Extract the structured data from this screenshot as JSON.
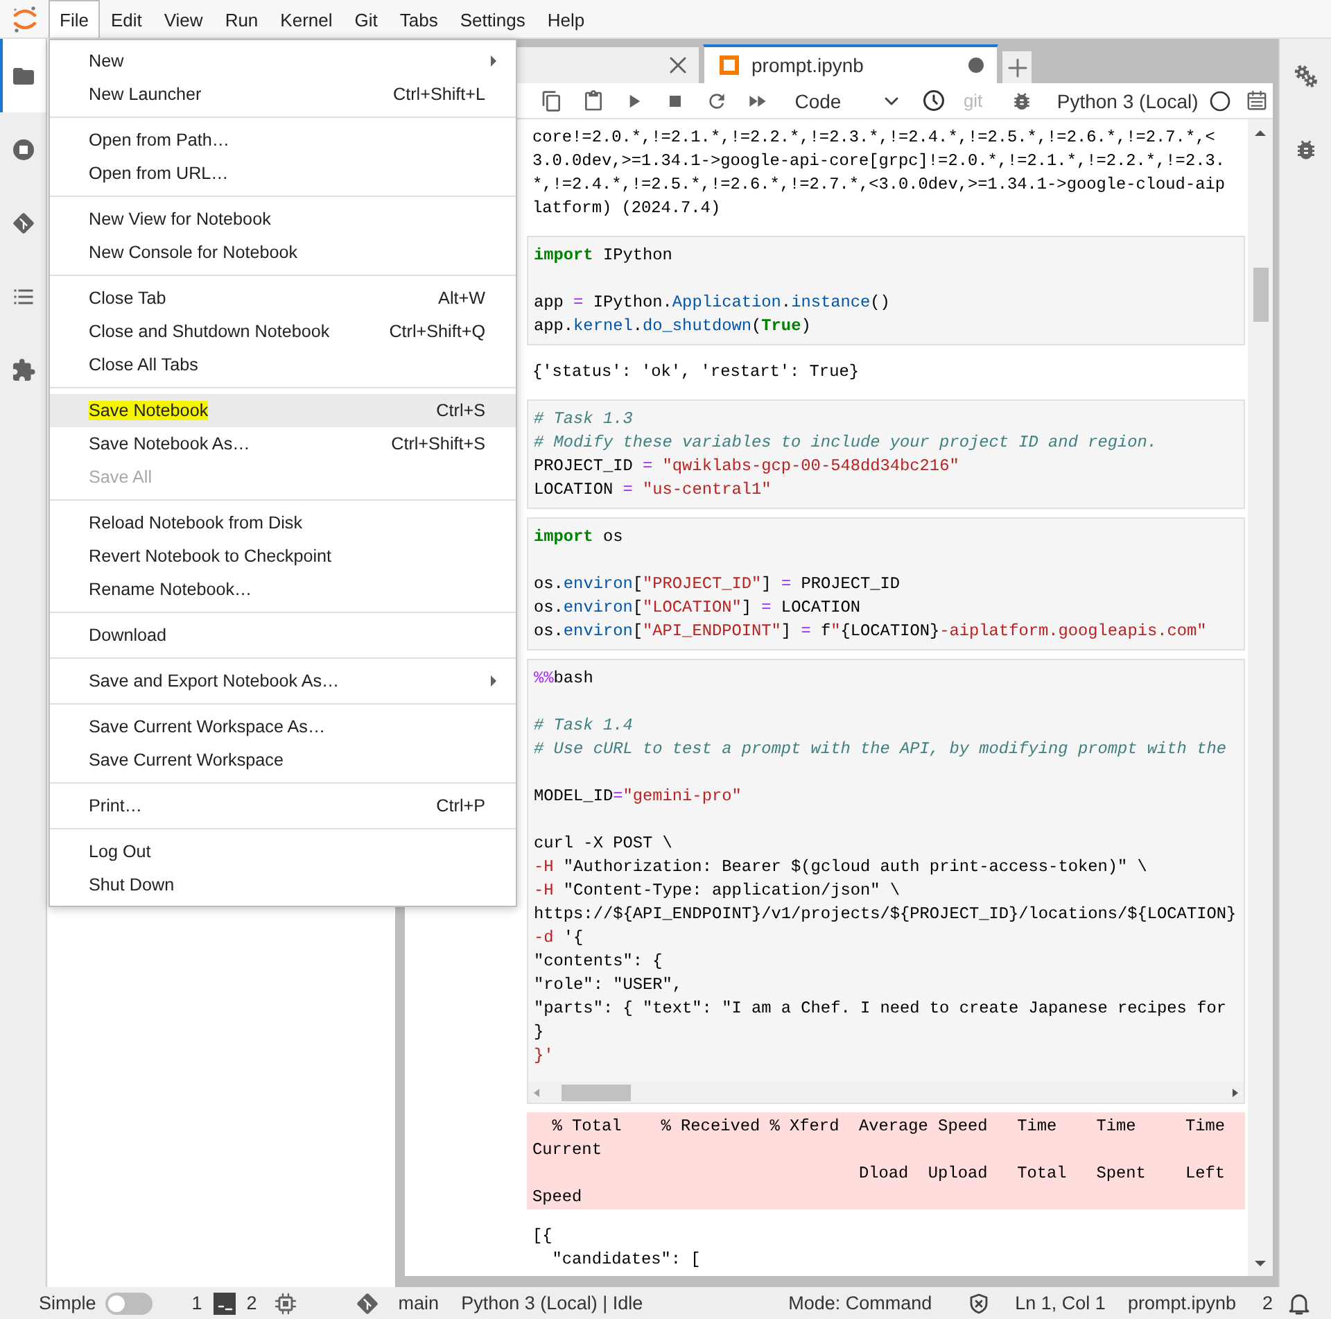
{
  "menubar": [
    {
      "label": "File",
      "selected": true
    },
    {
      "label": "Edit",
      "selected": false
    },
    {
      "label": "View",
      "selected": false
    },
    {
      "label": "Run",
      "selected": false
    },
    {
      "label": "Kernel",
      "selected": false
    },
    {
      "label": "Git",
      "selected": false
    },
    {
      "label": "Tabs",
      "selected": false
    },
    {
      "label": "Settings",
      "selected": false
    },
    {
      "label": "Help",
      "selected": false
    }
  ],
  "activity_bar": [
    {
      "kind": "folder",
      "selected": true
    },
    {
      "kind": "running",
      "selected": false
    },
    {
      "kind": "git",
      "selected": false
    },
    {
      "kind": "toc",
      "selected": false
    },
    {
      "kind": "extensions",
      "selected": false
    }
  ],
  "tabs": [
    {
      "selected": false,
      "dirty": false
    },
    {
      "label": "prompt.ipynb",
      "selected": true,
      "dirty": true
    }
  ],
  "toolbar": {
    "buttons": [
      {
        "kind": "copy"
      },
      {
        "kind": "paste"
      },
      {
        "kind": "run"
      },
      {
        "kind": "stop"
      },
      {
        "kind": "restart"
      },
      {
        "kind": "run-all"
      }
    ],
    "cell_type": "Code",
    "git_label": "git",
    "kernel_name": "Python 3 (Local)",
    "kernel_busy": false
  },
  "notebook": {
    "cells": [
      {
        "kind": "output",
        "lines": [
          {
            "kind": "text",
            "spans": [
              {
                "kind": "plain",
                "text": "core!=2.0.*,!=2.1.*,!=2.2.*,!=2.3.*,!=2.4.*,!=2.5.*,!=2.6.*,!=2.7.*,<"
              }
            ]
          },
          {
            "kind": "text",
            "spans": [
              {
                "kind": "plain",
                "text": "3.0.0dev,>=1.34.1->google-api-core[grpc]!=2.0.*,!=2.1.*,!=2.2.*,!=2.3."
              }
            ]
          },
          {
            "kind": "text",
            "spans": [
              {
                "kind": "plain",
                "text": "*,!=2.4.*,!=2.5.*,!=2.6.*,!=2.7.*,<3.0.0dev,>=1.34.1->google-cloud-aip"
              }
            ]
          },
          {
            "kind": "text",
            "spans": [
              {
                "kind": "plain",
                "text": "latform) (2024.7.4)"
              }
            ]
          }
        ]
      },
      {
        "kind": "code",
        "lines": [
          {
            "kind": "text",
            "spans": [
              {
                "kind": "keyword",
                "text": "import"
              },
              {
                "kind": "plain",
                "text": " IPython"
              }
            ]
          },
          {
            "kind": "blank"
          },
          {
            "kind": "text",
            "spans": [
              {
                "kind": "plain",
                "text": "app "
              },
              {
                "kind": "operator",
                "text": "="
              },
              {
                "kind": "plain",
                "text": " IPython."
              },
              {
                "kind": "property",
                "text": "Application"
              },
              {
                "kind": "plain",
                "text": "."
              },
              {
                "kind": "property",
                "text": "instance"
              },
              {
                "kind": "plain",
                "text": "()"
              }
            ]
          },
          {
            "kind": "text",
            "spans": [
              {
                "kind": "plain",
                "text": "app."
              },
              {
                "kind": "property",
                "text": "kernel"
              },
              {
                "kind": "plain",
                "text": "."
              },
              {
                "kind": "property",
                "text": "do_shutdown"
              },
              {
                "kind": "plain",
                "text": "("
              },
              {
                "kind": "keyword",
                "text": "True"
              },
              {
                "kind": "plain",
                "text": ")"
              }
            ]
          }
        ]
      },
      {
        "kind": "output",
        "lines": [
          {
            "kind": "text",
            "spans": [
              {
                "kind": "plain",
                "text": "{'status': 'ok', 'restart': True}"
              }
            ]
          }
        ]
      },
      {
        "kind": "code",
        "lines": [
          {
            "kind": "text",
            "spans": [
              {
                "kind": "comment",
                "text": "# Task 1.3"
              }
            ]
          },
          {
            "kind": "text",
            "spans": [
              {
                "kind": "comment",
                "text": "# Modify these variables to include your project ID and region."
              }
            ]
          },
          {
            "kind": "text",
            "spans": [
              {
                "kind": "plain",
                "text": "PROJECT_ID "
              },
              {
                "kind": "operator",
                "text": "="
              },
              {
                "kind": "string",
                "text": " \"qwiklabs-gcp-00-548dd34bc216\""
              }
            ]
          },
          {
            "kind": "text",
            "spans": [
              {
                "kind": "plain",
                "text": "LOCATION "
              },
              {
                "kind": "operator",
                "text": "="
              },
              {
                "kind": "string",
                "text": " \"us-central1\""
              }
            ]
          }
        ]
      },
      {
        "kind": "code",
        "lines": [
          {
            "kind": "text",
            "spans": [
              {
                "kind": "keyword",
                "text": "import"
              },
              {
                "kind": "plain",
                "text": " os"
              }
            ]
          },
          {
            "kind": "blank"
          },
          {
            "kind": "text",
            "spans": [
              {
                "kind": "plain",
                "text": "os."
              },
              {
                "kind": "property",
                "text": "environ"
              },
              {
                "kind": "plain",
                "text": "["
              },
              {
                "kind": "string",
                "text": "\"PROJECT_ID\""
              },
              {
                "kind": "plain",
                "text": "] "
              },
              {
                "kind": "operator",
                "text": "="
              },
              {
                "kind": "plain",
                "text": " PROJECT_ID"
              }
            ]
          },
          {
            "kind": "text",
            "spans": [
              {
                "kind": "plain",
                "text": "os."
              },
              {
                "kind": "property",
                "text": "environ"
              },
              {
                "kind": "plain",
                "text": "["
              },
              {
                "kind": "string",
                "text": "\"LOCATION\""
              },
              {
                "kind": "plain",
                "text": "] "
              },
              {
                "kind": "operator",
                "text": "="
              },
              {
                "kind": "plain",
                "text": " LOCATION"
              }
            ]
          },
          {
            "kind": "text",
            "spans": [
              {
                "kind": "plain",
                "text": "os."
              },
              {
                "kind": "property",
                "text": "environ"
              },
              {
                "kind": "plain",
                "text": "["
              },
              {
                "kind": "string",
                "text": "\"API_ENDPOINT\""
              },
              {
                "kind": "plain",
                "text": "] "
              },
              {
                "kind": "operator",
                "text": "="
              },
              {
                "kind": "plain",
                "text": " f"
              },
              {
                "kind": "string",
                "text": "\""
              },
              {
                "kind": "plain",
                "text": "{LOCATION}"
              },
              {
                "kind": "string",
                "text": "-aiplatform.googleapis.com\""
              }
            ]
          }
        ]
      },
      {
        "kind": "code",
        "hscroll": true,
        "lines": [
          {
            "kind": "text",
            "spans": [
              {
                "kind": "operator",
                "text": "%%"
              },
              {
                "kind": "plain",
                "text": "bash"
              }
            ]
          },
          {
            "kind": "blank"
          },
          {
            "kind": "text",
            "spans": [
              {
                "kind": "comment",
                "text": "# Task 1.4"
              }
            ]
          },
          {
            "kind": "text",
            "spans": [
              {
                "kind": "comment",
                "text": "# Use cURL to test a prompt with the API, by modifying prompt with the"
              }
            ]
          },
          {
            "kind": "blank"
          },
          {
            "kind": "text",
            "spans": [
              {
                "kind": "plain",
                "text": "MODEL_ID"
              },
              {
                "kind": "operator",
                "text": "="
              },
              {
                "kind": "string",
                "text": "\"gemini-pro\""
              }
            ]
          },
          {
            "kind": "blank"
          },
          {
            "kind": "text",
            "spans": [
              {
                "kind": "plain",
                "text": "curl -X POST \\"
              }
            ]
          },
          {
            "kind": "text",
            "spans": [
              {
                "kind": "string",
                "text": "-H"
              },
              {
                "kind": "plain",
                "text": " \"Authorization: Bearer $(gcloud auth print-access-token)\" \\"
              }
            ]
          },
          {
            "kind": "text",
            "spans": [
              {
                "kind": "string",
                "text": "-H"
              },
              {
                "kind": "plain",
                "text": " \"Content-Type: application/json\" \\"
              }
            ]
          },
          {
            "kind": "text",
            "spans": [
              {
                "kind": "plain",
                "text": "https://${API_ENDPOINT}/v1/projects/${PROJECT_ID}/locations/${LOCATION}"
              }
            ]
          },
          {
            "kind": "text",
            "spans": [
              {
                "kind": "string",
                "text": "-d"
              },
              {
                "kind": "plain",
                "text": " '{"
              }
            ]
          },
          {
            "kind": "text",
            "spans": [
              {
                "kind": "plain",
                "text": "\"contents\": {"
              }
            ]
          },
          {
            "kind": "text",
            "spans": [
              {
                "kind": "plain",
                "text": "\"role\": \"USER\","
              }
            ]
          },
          {
            "kind": "text",
            "spans": [
              {
                "kind": "plain",
                "text": "\"parts\": { \"text\": \"I am a Chef. I need to create Japanese recipes for"
              }
            ]
          },
          {
            "kind": "text",
            "spans": [
              {
                "kind": "plain",
                "text": "}"
              }
            ]
          },
          {
            "kind": "text",
            "spans": [
              {
                "kind": "string",
                "text": "}'"
              }
            ]
          }
        ]
      },
      {
        "kind": "stderr",
        "lines": [
          {
            "kind": "text",
            "spans": [
              {
                "kind": "plain",
                "text": "  % Total    % Received % Xferd  Average Speed   Time    Time     Time"
              }
            ]
          },
          {
            "kind": "text",
            "spans": [
              {
                "kind": "plain",
                "text": "Current"
              }
            ]
          },
          {
            "kind": "text",
            "spans": [
              {
                "kind": "plain",
                "text": "                                 Dload  Upload   Total   Spent    Left"
              }
            ]
          },
          {
            "kind": "text",
            "spans": [
              {
                "kind": "plain",
                "text": "Speed"
              }
            ]
          }
        ]
      },
      {
        "kind": "output",
        "lines": [
          {
            "kind": "text",
            "spans": [
              {
                "kind": "plain",
                "text": "[{"
              }
            ]
          },
          {
            "kind": "text",
            "spans": [
              {
                "kind": "plain",
                "text": "  \"candidates\": ["
              }
            ]
          }
        ]
      }
    ]
  },
  "right_bar": [
    {
      "kind": "property-inspector",
      "selected": false
    },
    {
      "kind": "debugger",
      "selected": false
    }
  ],
  "file_menu": {
    "groups": [
      [
        {
          "label": "New",
          "submenu": true,
          "selected": false,
          "disabled": false,
          "highlighted": false
        },
        {
          "label": "New Launcher",
          "shortcut": "Ctrl+Shift+L",
          "selected": false,
          "disabled": false,
          "highlighted": false
        }
      ],
      [
        {
          "label": "Open from Path…",
          "selected": false,
          "disabled": false,
          "highlighted": false
        },
        {
          "label": "Open from URL…",
          "selected": false,
          "disabled": false,
          "highlighted": false
        }
      ],
      [
        {
          "label": "New View for Notebook",
          "selected": false,
          "disabled": false,
          "highlighted": false
        },
        {
          "label": "New Console for Notebook",
          "selected": false,
          "disabled": false,
          "highlighted": false
        }
      ],
      [
        {
          "label": "Close Tab",
          "shortcut": "Alt+W",
          "selected": false,
          "disabled": false,
          "highlighted": false
        },
        {
          "label": "Close and Shutdown Notebook",
          "shortcut": "Ctrl+Shift+Q",
          "selected": false,
          "disabled": false,
          "highlighted": false
        },
        {
          "label": "Close All Tabs",
          "selected": false,
          "disabled": false,
          "highlighted": false
        }
      ],
      [
        {
          "label": "Save Notebook",
          "shortcut": "Ctrl+S",
          "selected": true,
          "disabled": false,
          "highlighted": true
        },
        {
          "label": "Save Notebook As…",
          "shortcut": "Ctrl+Shift+S",
          "selected": false,
          "disabled": false,
          "highlighted": false
        },
        {
          "label": "Save All",
          "selected": false,
          "disabled": true,
          "highlighted": false
        }
      ],
      [
        {
          "label": "Reload Notebook from Disk",
          "selected": false,
          "disabled": false,
          "highlighted": false
        },
        {
          "label": "Revert Notebook to Checkpoint",
          "selected": false,
          "disabled": false,
          "highlighted": false
        },
        {
          "label": "Rename Notebook…",
          "selected": false,
          "disabled": false,
          "highlighted": false
        }
      ],
      [
        {
          "label": "Download",
          "selected": false,
          "disabled": false,
          "highlighted": false
        }
      ],
      [
        {
          "label": "Save and Export Notebook As…",
          "submenu": true,
          "selected": false,
          "disabled": false,
          "highlighted": false
        }
      ],
      [
        {
          "label": "Save Current Workspace As…",
          "selected": false,
          "disabled": false,
          "highlighted": false
        },
        {
          "label": "Save Current Workspace",
          "selected": false,
          "disabled": false,
          "highlighted": false
        }
      ],
      [
        {
          "label": "Print…",
          "shortcut": "Ctrl+P",
          "selected": false,
          "disabled": false,
          "highlighted": false
        }
      ],
      [
        {
          "label": "Log Out",
          "selected": false,
          "disabled": false,
          "highlighted": false
        },
        {
          "label": "Shut Down",
          "selected": false,
          "disabled": false,
          "highlighted": false
        }
      ]
    ]
  },
  "status_bar": {
    "simple_label": "Simple",
    "simple_mode": false,
    "terminals": "1",
    "kernels": "2",
    "branch": "main",
    "kernel_status": "Python 3 (Local) | Idle",
    "mode": "Mode: Command",
    "position": "Ln 1, Col 1",
    "file": "prompt.ipynb",
    "notifications": "2"
  }
}
